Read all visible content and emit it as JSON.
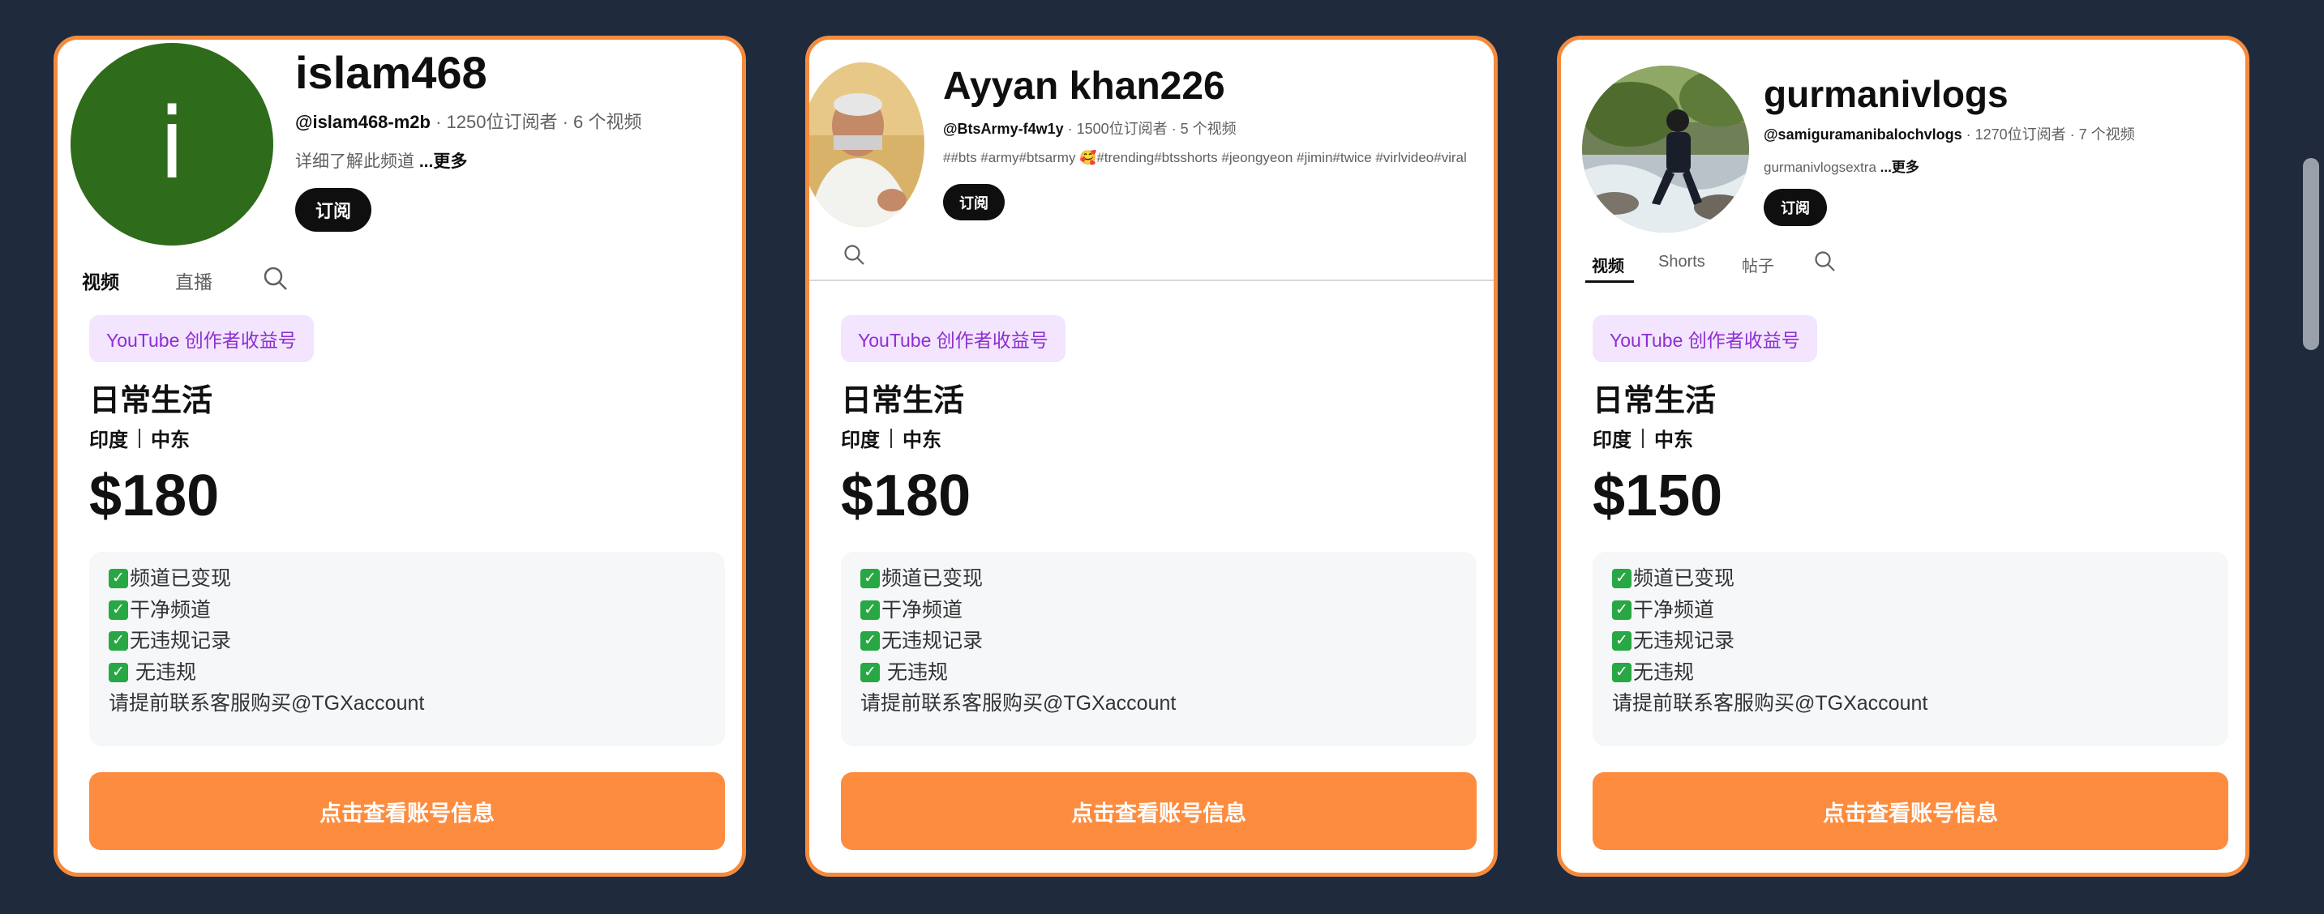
{
  "accounts": [
    {
      "channel": {
        "name": "islam468",
        "handle": "@islam468-m2b",
        "meta": " · 1250位订阅者 · 6 个视频",
        "description": "详细了解此频道 ",
        "more": "...更多",
        "subscribe": "订阅",
        "avatar_letter": "i",
        "avatar_color": "#2e6b1a",
        "tabs": [
          "视频",
          "直播"
        ]
      },
      "badge": "YouTube 创作者收益号",
      "category": "日常生活",
      "regions": [
        "印度",
        "中东"
      ],
      "price": "$180",
      "features": [
        "频道已变现",
        "干净频道",
        "无违规记录",
        " 无违规"
      ],
      "contact": "请提前联系客服购买@TGXaccount",
      "cta": "点击查看账号信息"
    },
    {
      "channel": {
        "name": "Ayyan khan226",
        "handle": "@BtsArmy-f4w1y",
        "meta": " · 1500位订阅者 · 5 个视频",
        "description": "##bts #army#btsarmy 🥰#trending#btsshorts #jeongyeon #jimin#twice  #virlvideo#viral",
        "subscribe": "订阅"
      },
      "badge": "YouTube 创作者收益号",
      "category": "日常生活",
      "regions": [
        "印度",
        "中东"
      ],
      "price": "$180",
      "features": [
        "频道已变现",
        "干净频道",
        "无违规记录",
        " 无违规"
      ],
      "contact": "请提前联系客服购买@TGXaccount",
      "cta": "点击查看账号信息"
    },
    {
      "channel": {
        "name": "gurmanivlogs",
        "handle": "@samiguramanibalochvlogs",
        "meta": " · 1270位订阅者 · 7 个视频",
        "description": "gurmanivlogsextra ",
        "more": "...更多",
        "subscribe": "订阅",
        "tabs": [
          "视频",
          "Shorts",
          "帖子"
        ]
      },
      "badge": "YouTube 创作者收益号",
      "category": "日常生活",
      "regions": [
        "印度",
        "中东"
      ],
      "price": "$150",
      "features": [
        "频道已变现",
        "干净频道",
        "无违规记录",
        "无违规"
      ],
      "contact": "请提前联系客服购买@TGXaccount",
      "cta": "点击查看账号信息"
    }
  ],
  "colors": {
    "page_bg": "#1f2a3c",
    "card_border": "#f58a3c",
    "cta": "#fd8c3f",
    "badge_bg": "#f3e5fd",
    "badge_text": "#8d2ed3"
  }
}
